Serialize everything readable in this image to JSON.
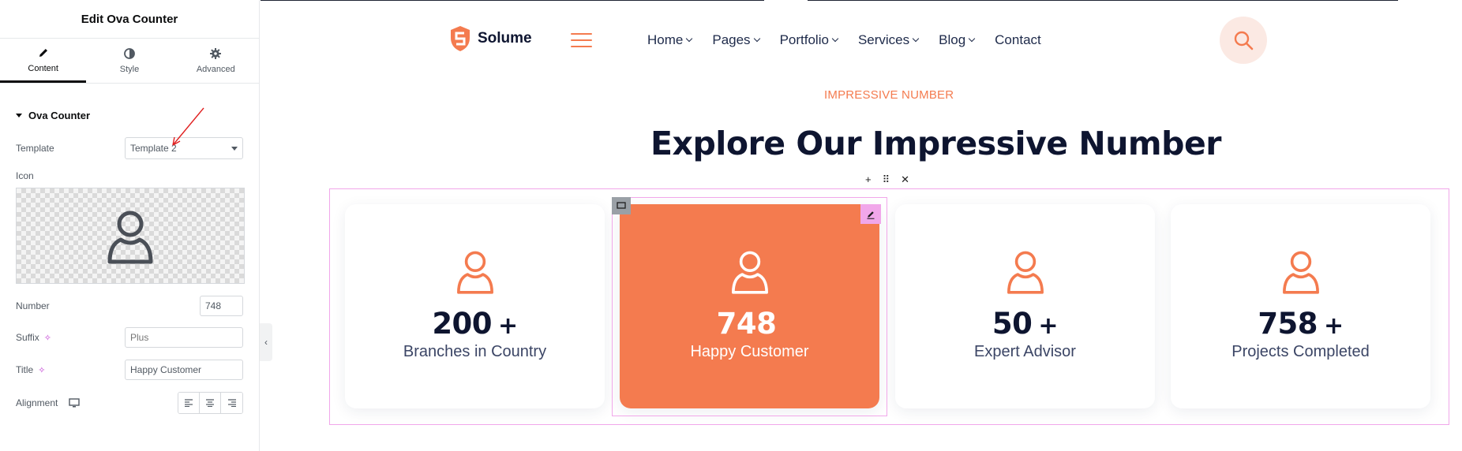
{
  "panel": {
    "title": "Edit Ova Counter",
    "tabs": [
      {
        "label": "Content",
        "icon": "pencil-icon",
        "active": true
      },
      {
        "label": "Style",
        "icon": "half-circle-icon",
        "active": false
      },
      {
        "label": "Advanced",
        "icon": "gear-icon",
        "active": false
      }
    ],
    "section_title": "Ova Counter",
    "fields": {
      "template": {
        "label": "Template",
        "value": "Template 2"
      },
      "icon": {
        "label": "Icon"
      },
      "number": {
        "label": "Number",
        "value": "748"
      },
      "suffix": {
        "label": "Suffix",
        "placeholder": "Plus"
      },
      "title": {
        "label": "Title",
        "value": "Happy Customer"
      },
      "alignment": {
        "label": "Alignment"
      }
    }
  },
  "site": {
    "brand": "Solume",
    "nav": [
      {
        "label": "Home",
        "dropdown": true
      },
      {
        "label": "Pages",
        "dropdown": true
      },
      {
        "label": "Portfolio",
        "dropdown": true
      },
      {
        "label": "Services",
        "dropdown": true
      },
      {
        "label": "Blog",
        "dropdown": true
      },
      {
        "label": "Contact",
        "dropdown": false
      }
    ],
    "eyebrow": "IMPRESSIVE NUMBER",
    "heading": "Explore Our Impressive Number",
    "counters": [
      {
        "number": "200",
        "suffix": "+",
        "title": "Branches in Country",
        "active": false
      },
      {
        "number": "748",
        "suffix": "",
        "title": "Happy Customer",
        "active": true
      },
      {
        "number": "50",
        "suffix": "+",
        "title": "Expert Advisor",
        "active": false
      },
      {
        "number": "758",
        "suffix": "+",
        "title": "Projects Completed",
        "active": false
      }
    ]
  },
  "colors": {
    "accent": "#f47b4f",
    "dark": "#0e1530",
    "editor_outline": "#f1a7ea"
  }
}
